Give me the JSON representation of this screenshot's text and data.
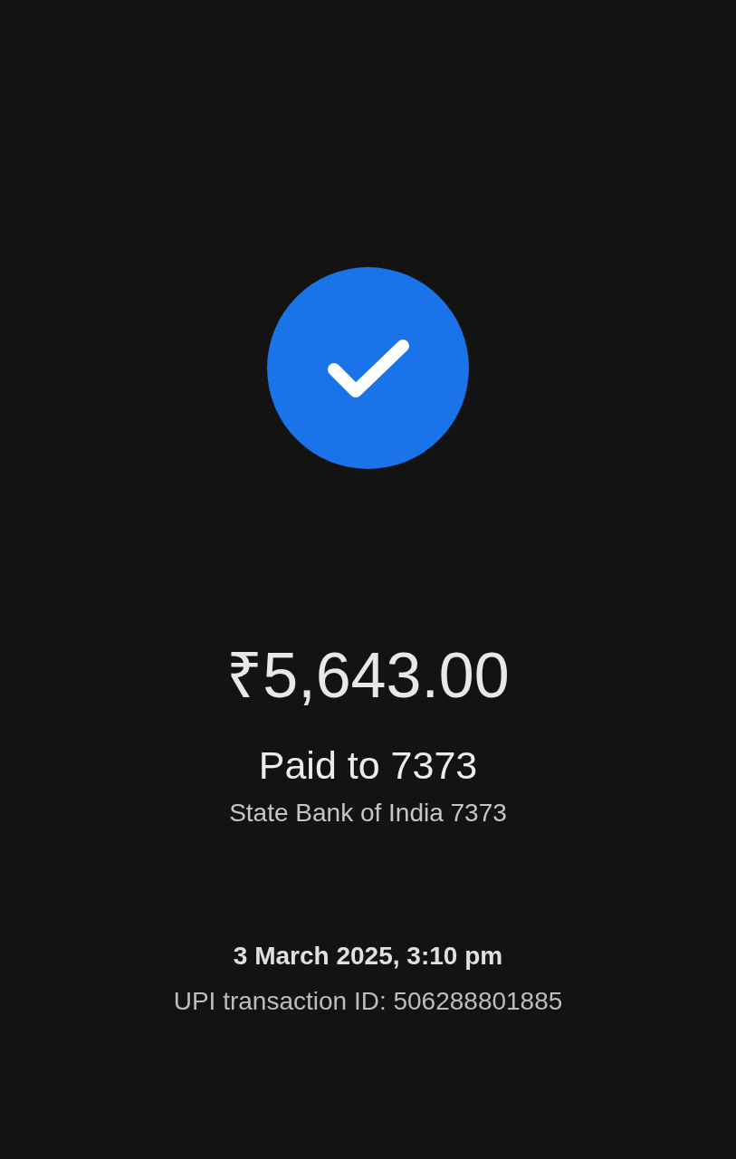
{
  "status": {
    "kind": "success"
  },
  "amount": "₹5,643.00",
  "recipient": "Paid to 7373",
  "account": "State Bank of India 7373",
  "datetime": "3 March 2025, 3:10 pm",
  "transaction_id": "UPI transaction ID: 506288801885"
}
